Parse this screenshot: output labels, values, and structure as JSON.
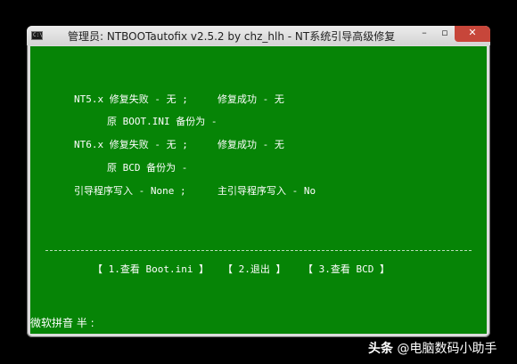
{
  "window": {
    "title": "管理员:  NTBOOTautofix v2.5.2 by chz_hlh - NT系统引导高级修复",
    "icon": "console-icon",
    "controls": {
      "minimize": "–",
      "maximize": "▫",
      "close": "✕"
    }
  },
  "console": {
    "nt5_fail": "NT5.x 修复失败 - 无 ;",
    "nt5_success": "修复成功 - 无",
    "nt5_backup": "原 BOOT.INI 备份为 -",
    "nt6_fail": "NT6.x 修复失败 - 无 ;",
    "nt6_success": "修复成功 - 无",
    "nt6_backup": "原 BCD 备份为 -",
    "bootcode_write": "引导程序写入 - None ;",
    "mbr_write": "主引导程序写入 - No",
    "divider": "-------------------------------------------------------------------------------",
    "menu": [
      {
        "label": "【 1.查看 Boot.ini 】"
      },
      {
        "label": "【 2.退出 】"
      },
      {
        "label": "【   3.查看   BCD   】"
      }
    ],
    "ime_status": "微软拼音 半 :"
  },
  "watermark": {
    "brand": "头条",
    "author": "@电脑数码小助手"
  },
  "colors": {
    "console_bg": "#068406",
    "console_fg": "#ffffff",
    "close_button": "#c7463a"
  }
}
